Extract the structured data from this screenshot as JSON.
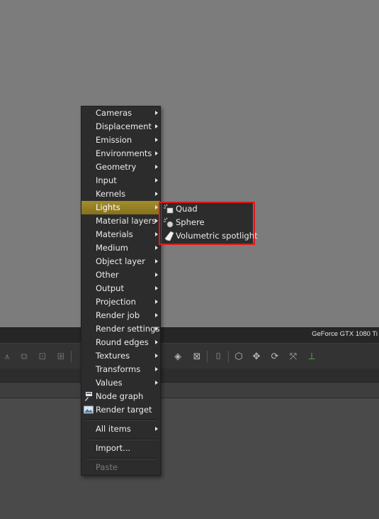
{
  "statusbar": {
    "gpu_label": "GeForce GTX 1080 Ti"
  },
  "toolbar": {
    "icons": [
      "fx-icon",
      "camera-icon",
      "lock-icon",
      "grid-icon",
      "render-icon",
      "object-icon",
      "cube-icon",
      "move-icon",
      "rotate-icon",
      "scale-icon",
      "axis-icon"
    ]
  },
  "context_menu": {
    "items": [
      {
        "label": "Cameras",
        "submenu": true
      },
      {
        "label": "Displacement",
        "submenu": true
      },
      {
        "label": "Emission",
        "submenu": true
      },
      {
        "label": "Environments",
        "submenu": true
      },
      {
        "label": "Geometry",
        "submenu": true
      },
      {
        "label": "Input",
        "submenu": true
      },
      {
        "label": "Kernels",
        "submenu": true
      },
      {
        "label": "Lights",
        "submenu": true,
        "highlighted": true
      },
      {
        "label": "Material layers",
        "submenu": true
      },
      {
        "label": "Materials",
        "submenu": true
      },
      {
        "label": "Medium",
        "submenu": true
      },
      {
        "label": "Object layer",
        "submenu": true
      },
      {
        "label": "Other",
        "submenu": true
      },
      {
        "label": "Output",
        "submenu": true
      },
      {
        "label": "Projection",
        "submenu": true
      },
      {
        "label": "Render job",
        "submenu": true
      },
      {
        "label": "Render settings",
        "submenu": true
      },
      {
        "label": "Round edges",
        "submenu": true
      },
      {
        "label": "Textures",
        "submenu": true
      },
      {
        "label": "Transforms",
        "submenu": true
      },
      {
        "label": "Values",
        "submenu": true
      },
      {
        "label": "Node graph",
        "icon": "node-graph-icon"
      },
      {
        "label": "Render target",
        "icon": "render-target-icon"
      }
    ],
    "all_items": "All items",
    "import": "Import...",
    "paste": "Paste"
  },
  "lights_submenu": {
    "items": [
      {
        "label": "Quad",
        "icon": "quad-light-icon"
      },
      {
        "label": "Sphere",
        "icon": "sphere-light-icon"
      },
      {
        "label": "Volumetric spotlight",
        "icon": "spotlight-icon"
      }
    ]
  },
  "colors": {
    "highlight": "#9a8426",
    "annotation_box": "#e0171b",
    "menu_bg": "#2c2c2c"
  }
}
